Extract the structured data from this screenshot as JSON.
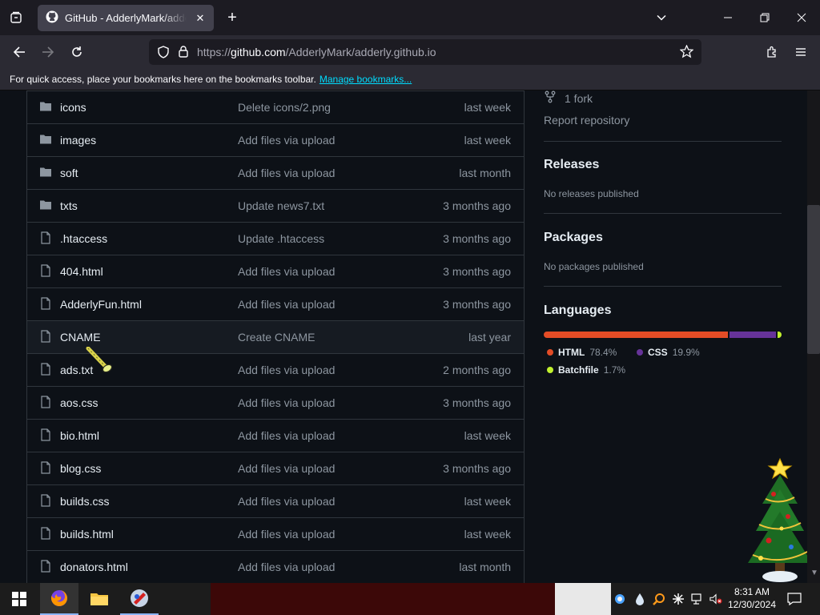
{
  "browser": {
    "tab": {
      "title": "GitHub - AdderlyMark/adderly.github.io"
    },
    "url": {
      "prefix": "https://",
      "host": "github.com",
      "path": "/AdderlyMark/adderly.github.io"
    },
    "bookmarks_bar": {
      "message": "For quick access, place your bookmarks here on the bookmarks toolbar.",
      "link": "Manage bookmarks..."
    }
  },
  "files": [
    {
      "type": "folder",
      "name": "icons",
      "message": "Delete icons/2.png",
      "age": "last week"
    },
    {
      "type": "folder",
      "name": "images",
      "message": "Add files via upload",
      "age": "last week"
    },
    {
      "type": "folder",
      "name": "soft",
      "message": "Add files via upload",
      "age": "last month"
    },
    {
      "type": "folder",
      "name": "txts",
      "message": "Update news7.txt",
      "age": "3 months ago"
    },
    {
      "type": "file",
      "name": ".htaccess",
      "message": "Update .htaccess",
      "age": "3 months ago"
    },
    {
      "type": "file",
      "name": "404.html",
      "message": "Add files via upload",
      "age": "3 months ago"
    },
    {
      "type": "file",
      "name": "AdderlyFun.html",
      "message": "Add files via upload",
      "age": "3 months ago"
    },
    {
      "type": "file",
      "name": "CNAME",
      "message": "Create CNAME",
      "age": "last year"
    },
    {
      "type": "file",
      "name": "ads.txt",
      "message": "Add files via upload",
      "age": "2 months ago"
    },
    {
      "type": "file",
      "name": "aos.css",
      "message": "Add files via upload",
      "age": "3 months ago"
    },
    {
      "type": "file",
      "name": "bio.html",
      "message": "Add files via upload",
      "age": "last week"
    },
    {
      "type": "file",
      "name": "blog.css",
      "message": "Add files via upload",
      "age": "3 months ago"
    },
    {
      "type": "file",
      "name": "builds.css",
      "message": "Add files via upload",
      "age": "last week"
    },
    {
      "type": "file",
      "name": "builds.html",
      "message": "Add files via upload",
      "age": "last week"
    },
    {
      "type": "file",
      "name": "donators.html",
      "message": "Add files via upload",
      "age": "last month"
    }
  ],
  "sidebar": {
    "forks": "1 fork",
    "report": "Report repository",
    "releases": {
      "title": "Releases",
      "empty": "No releases published"
    },
    "packages": {
      "title": "Packages",
      "empty": "No packages published"
    },
    "languages": {
      "title": "Languages",
      "items": [
        {
          "name": "HTML",
          "percent": "78.4%",
          "value": 78.4,
          "color": "#e34c26"
        },
        {
          "name": "CSS",
          "percent": "19.9%",
          "value": 19.9,
          "color": "#663399"
        },
        {
          "name": "Batchfile",
          "percent": "1.7%",
          "value": 1.7,
          "color": "#c1f12e"
        }
      ]
    }
  },
  "taskbar": {
    "time": "8:31 AM",
    "date": "12/30/2024"
  }
}
